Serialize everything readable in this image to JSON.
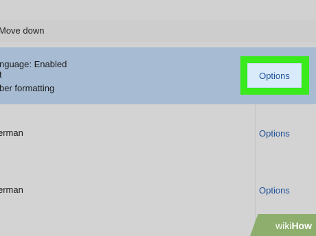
{
  "toolbar": {
    "move_down_label": "Move down"
  },
  "languages": [
    {
      "line1": "nguage: Enabled",
      "line2": "t",
      "line3": "ber formatting",
      "options_label": "Options"
    },
    {
      "name": "erman",
      "options_label": "Options"
    },
    {
      "name": "erman",
      "options_label": "Options"
    }
  ],
  "watermark": {
    "wiki": "wiki",
    "how": "How"
  },
  "colors": {
    "selected_row": "#a7bcd3",
    "highlight_box": "#39ea1c",
    "options_button_bg": "#d9ebfa",
    "link_blue": "#1f5199"
  }
}
